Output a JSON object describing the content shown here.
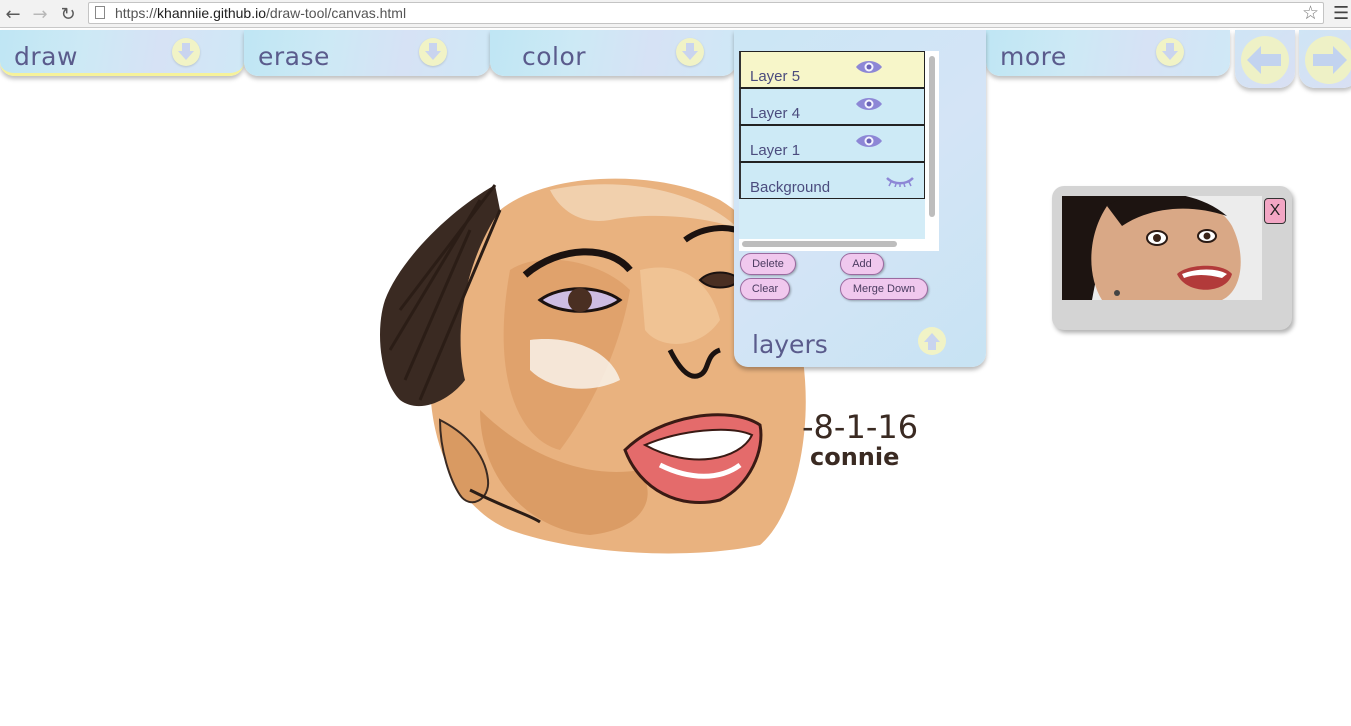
{
  "browser": {
    "url_scheme": "https://",
    "url_host": "khanniie.github.io",
    "url_path": "/draw-tool/canvas.html",
    "icons": {
      "back": "back-arrow-icon",
      "forward": "forward-arrow-icon",
      "reload": "reload-icon",
      "page": "page-icon",
      "bookmark": "star-icon",
      "menu": "hamburger-menu-icon"
    }
  },
  "toolbar": {
    "tabs": [
      {
        "label": "draw",
        "active": true
      },
      {
        "label": "erase",
        "active": false
      },
      {
        "label": "color",
        "active": false
      },
      {
        "label": "more",
        "active": false
      }
    ],
    "undo_icon": "undo-arrow-icon",
    "redo_icon": "redo-arrow-icon"
  },
  "layers_panel": {
    "title": "layers",
    "layers": [
      {
        "name": "Layer 5",
        "visible": true,
        "active": true
      },
      {
        "name": "Layer 4",
        "visible": true,
        "active": false
      },
      {
        "name": "Layer 1",
        "visible": true,
        "active": false
      },
      {
        "name": "Background",
        "visible": false,
        "active": false
      }
    ],
    "buttons": {
      "delete": "Delete",
      "add": "Add",
      "clear": "Clear",
      "merge_down": "Merge Down"
    }
  },
  "reference_window": {
    "close_label": "X",
    "image_icon": "reference-photo-face"
  },
  "drawing": {
    "signature_date": "-8-1-16",
    "signature_name": "connie"
  },
  "colors": {
    "tab_bg": "#cde9f5",
    "tab_text": "#5a5b8c",
    "active_layer": "#f7f6c9",
    "pill": "#f0c8ee",
    "close_button": "#f2a6c4"
  }
}
